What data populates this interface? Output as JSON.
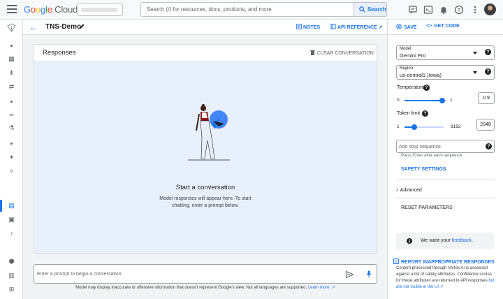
{
  "topbar": {
    "logo": {
      "part1": "G",
      "part2": "o",
      "part3": "o",
      "part4": "g",
      "part5": "l",
      "part6": "e",
      "rest": " Cloud"
    },
    "search_placeholder": "Search (/) for resources, docs, products, and more",
    "search_button": "Search"
  },
  "header": {
    "title": "TNS-Demo",
    "notes_label": "NOTES",
    "api_reference_label": "API REFERENCE"
  },
  "responses": {
    "title": "Responses",
    "clear_label": "CLEAR CONVERSATION",
    "empty_title": "Start a conversation",
    "empty_description": "Model responses will appear here. To start chatting, enter a prompt below."
  },
  "prompt": {
    "placeholder": "Enter a prompt to begin a conversation",
    "disclaimer": "Model may display inaccurate or offensive information that doesn't represent Google's view. Not all languages are supported.",
    "learn_more": "Learn more."
  },
  "settings": {
    "save_label": "SAVE",
    "get_code_label": "GET CODE",
    "model": {
      "label": "Model",
      "value": "Gemini Pro"
    },
    "region": {
      "label": "Region",
      "value": "us-central1 (Iowa)"
    },
    "temperature": {
      "label": "Temperature",
      "min": "0",
      "max": "1",
      "value": "0.9",
      "fraction": 0.9
    },
    "token_limit": {
      "label": "Token limit",
      "min": "1",
      "max": "8192",
      "value": "2048",
      "fraction": 0.25
    },
    "stop_sequence": {
      "placeholder": "Add stop sequence",
      "hint": "Press Enter after each sequence"
    },
    "safety_settings_label": "SAFETY SETTINGS",
    "advanced_label": "Advanced",
    "reset_label": "RESET PARAMETERS",
    "feedback_prefix": "We want your",
    "feedback_link": "feedback.",
    "report_label": "REPORT INAPPROPRIATE RESPONSES",
    "vertex_note_prefix": "Content processed through Vertex AI is assessed against a list of safety attributes. Confidence scores for these attributes are returned in API responses",
    "vertex_note_link": "but are not visible in the UI"
  },
  "colors": {
    "accent": "#1a73e8",
    "empty_area": "#e8f0fe",
    "canvas": "#f1f3f4"
  }
}
